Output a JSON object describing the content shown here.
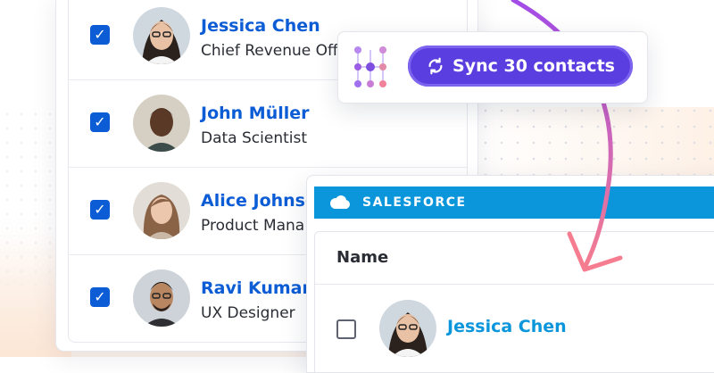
{
  "contacts": [
    {
      "name": "Jessica Chen",
      "title": "Chief Revenue Offi",
      "checked": true
    },
    {
      "name": "John Müller",
      "title": "Data Scientist",
      "checked": true
    },
    {
      "name": "Alice Johnso",
      "title": "Product Mana",
      "checked": true
    },
    {
      "name": "Ravi Kumar",
      "title": "UX Designer",
      "checked": true
    }
  ],
  "sync": {
    "label": "Sync 30 contacts",
    "icon": "sync-icon",
    "color": "#5b3ee0"
  },
  "salesforce": {
    "brand": "SALESFORCE",
    "brand_color": "#0b96db",
    "column_header": "Name",
    "rows": [
      {
        "name": "Jessica Chen",
        "checked": false
      }
    ]
  },
  "accent": "#0b5cd5"
}
